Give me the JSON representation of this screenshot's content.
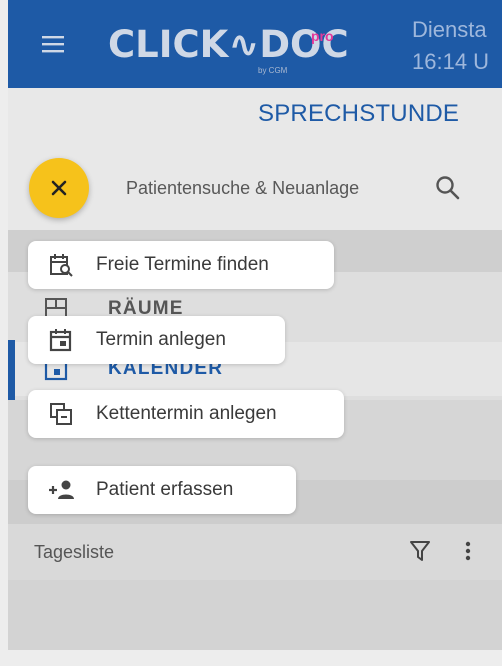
{
  "header": {
    "logo_text": "CLICK∿DOC",
    "logo_pro": "pro",
    "logo_by": "by CGM",
    "day_label": "Diensta",
    "time_label": "16:14 U",
    "menu_icon": "hamburger-menu-icon"
  },
  "section": {
    "title": "SPRECHSTUNDE"
  },
  "search": {
    "placeholder": "Patientensuche & Neuanlage",
    "icon": "search-icon"
  },
  "nav": {
    "items": [
      {
        "label": "RÄUME",
        "icon": "rooms-icon"
      },
      {
        "label": "KALENDER",
        "icon": "calendar-icon",
        "active": true
      }
    ]
  },
  "fab": {
    "icon": "close-icon",
    "color": "#f6c21b"
  },
  "actions": [
    {
      "label": "Freie Termine finden",
      "icon": "calendar-search-icon"
    },
    {
      "label": "Termin anlegen",
      "icon": "calendar-add-icon"
    },
    {
      "label": "Kettentermin anlegen",
      "icon": "chain-appointment-icon"
    },
    {
      "label": "Patient erfassen",
      "icon": "add-person-icon"
    }
  ],
  "tagesliste": {
    "label": "Tagesliste",
    "filter_icon": "filter-icon",
    "more_icon": "more-vert-icon"
  },
  "colors": {
    "brand_blue": "#1e5aa6",
    "fab_yellow": "#f6c21b"
  }
}
